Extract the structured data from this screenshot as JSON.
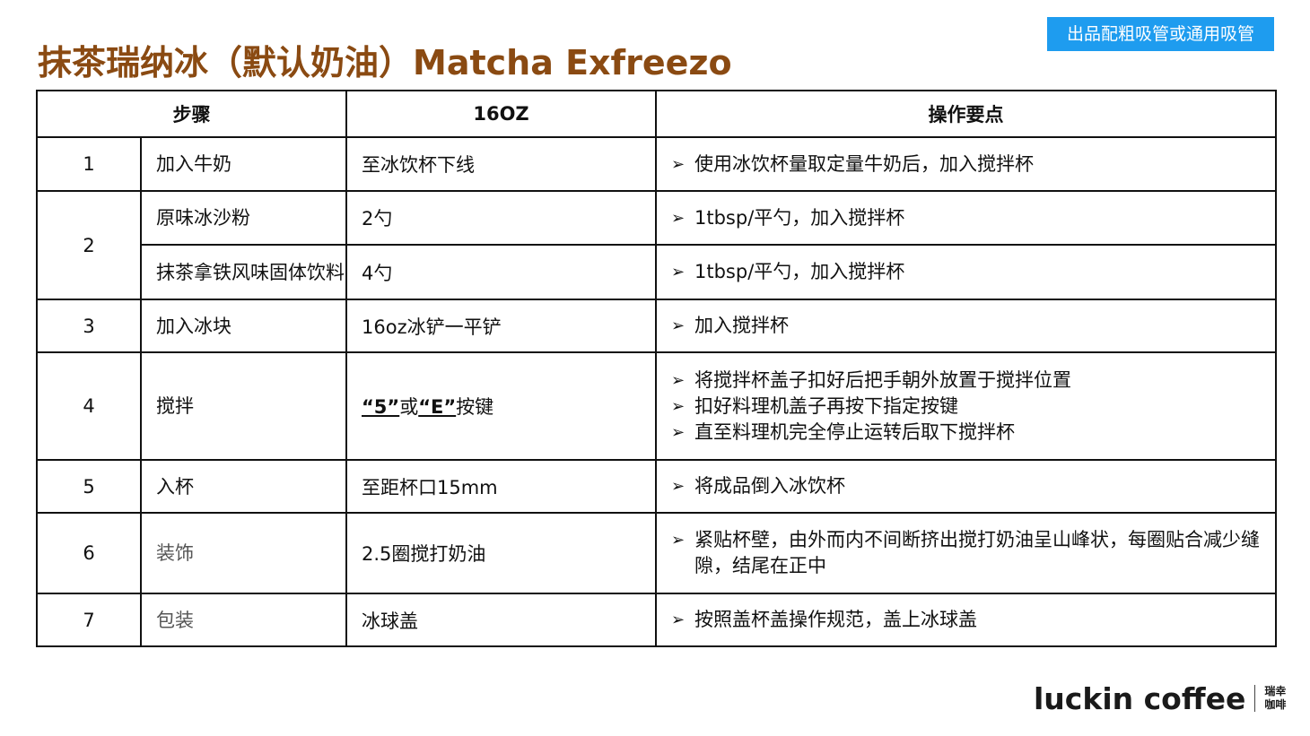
{
  "title": "抹茶瑞纳冰（默认奶油）Matcha Exfreezo",
  "badge": "出品配粗吸管或通用吸管",
  "table": {
    "headers": {
      "step": "步骤",
      "size": "16OZ",
      "notes": "操作要点"
    },
    "rows": [
      {
        "num": "1",
        "item": "加入牛奶",
        "amount": "至冰饮杯下线",
        "notes": [
          "使用冰饮杯量取定量牛奶后，加入搅拌杯"
        ]
      },
      {
        "num": "2",
        "item": "原味冰沙粉",
        "amount": "2勺",
        "notes": [
          "1tbsp/平勺，加入搅拌杯"
        ]
      },
      {
        "item": "抹茶拿铁风味固体饮料",
        "amount": "4勺",
        "notes": [
          "1tbsp/平勺，加入搅拌杯"
        ]
      },
      {
        "num": "3",
        "item": "加入冰块",
        "amount": "16oz冰铲一平铲",
        "notes": [
          "加入搅拌杯"
        ]
      },
      {
        "num": "4",
        "item": "搅拌",
        "amount_parts": [
          "“5”",
          "或",
          "“E”",
          "按键"
        ],
        "notes": [
          "将搅拌杯盖子扣好后把手朝外放置于搅拌位置",
          "扣好料理机盖子再按下指定按键",
          "直至料理机完全停止运转后取下搅拌杯"
        ]
      },
      {
        "num": "5",
        "item": "入杯",
        "amount": "至距杯口15mm",
        "notes": [
          "将成品倒入冰饮杯"
        ]
      },
      {
        "num": "6",
        "item": "装饰",
        "amount": "2.5圈搅打奶油",
        "notes": [
          "紧贴杯壁，由外而内不间断挤出搅打奶油呈山峰状，每圈贴合减少缝隙，结尾在正中"
        ]
      },
      {
        "num": "7",
        "item": "包装",
        "amount": "冰球盖",
        "notes": [
          "按照盖杯盖操作规范，盖上冰球盖"
        ]
      }
    ]
  },
  "logo": {
    "text": "luckin coffee",
    "cn_line1": "瑞幸",
    "cn_line2": "咖啡"
  },
  "colors": {
    "title": "#8a4a12",
    "badge_bg": "#1e9cef",
    "badge_text": "#ffffff"
  },
  "icons": {
    "bullet": "arrow-bullet-icon"
  }
}
